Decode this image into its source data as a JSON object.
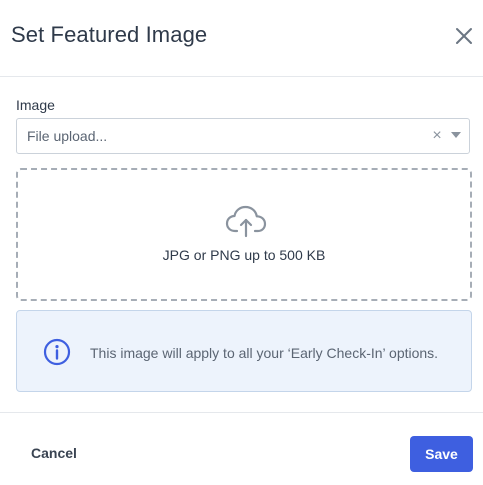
{
  "dialog": {
    "title": "Set Featured Image",
    "close_icon": "close-icon"
  },
  "image_field": {
    "label": "Image",
    "select_value": "File upload...",
    "clear_glyph": "×",
    "caret_icon": "chevron-down-icon"
  },
  "dropzone": {
    "icon": "cloud-upload-icon",
    "hint": "JPG or PNG up to 500 KB"
  },
  "info": {
    "icon": "info-icon",
    "message": "This image will apply to all your ‘Early Check-In’ options."
  },
  "footer": {
    "cancel_label": "Cancel",
    "save_label": "Save"
  },
  "colors": {
    "primary": "#3e5fe0",
    "info_background": "#edf3fc",
    "info_icon": "#3e5fe0",
    "upload_icon": "#8a939e"
  }
}
